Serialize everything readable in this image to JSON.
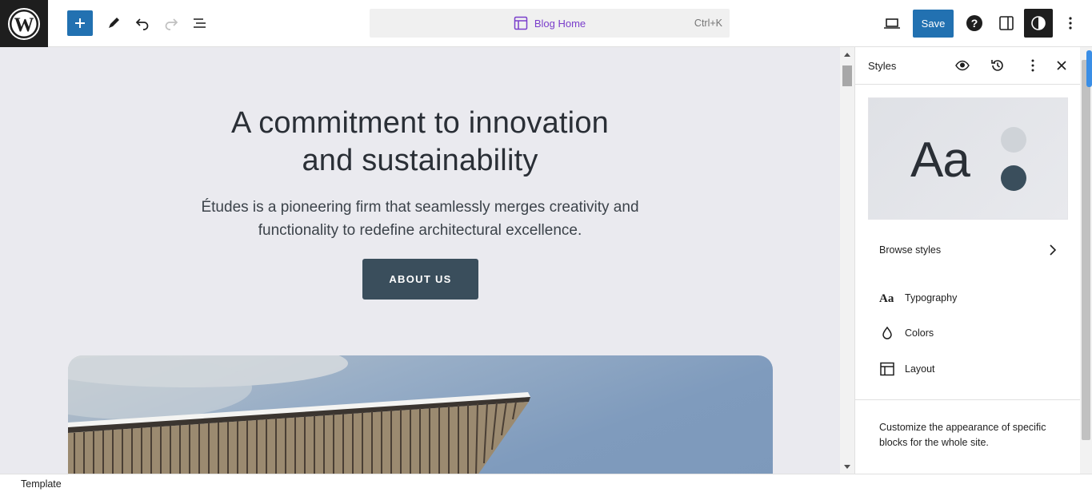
{
  "topbar": {
    "command": {
      "title": "Blog Home",
      "shortcut": "Ctrl+K"
    },
    "save_label": "Save",
    "icons": [
      "wordpress-logo",
      "plus-icon",
      "pencil-icon",
      "undo-icon",
      "redo-icon",
      "list-view-icon",
      "desktop-view-icon",
      "help-icon",
      "sidebar-icon",
      "contrast-icon",
      "more-vertical-icon"
    ],
    "accent": "#2271b1"
  },
  "canvas": {
    "heading_line1": "A commitment to innovation",
    "heading_line2": "and sustainability",
    "text_line1": "Études is a pioneering firm that seamlessly merges creativity and",
    "text_line2": "functionality to redefine architectural excellence.",
    "button_label": "ABOUT US",
    "button_color": "#3a4e5c"
  },
  "sidebar": {
    "title": "Styles",
    "preview_text": "Aa",
    "browse_label": "Browse styles",
    "items": [
      {
        "label": "Typography",
        "icon": "typography-icon"
      },
      {
        "label": "Colors",
        "icon": "droplet-icon"
      },
      {
        "label": "Layout",
        "icon": "layout-icon"
      }
    ],
    "description": "Customize the appearance of specific blocks for the whole site."
  },
  "footer": {
    "label": "Template"
  }
}
